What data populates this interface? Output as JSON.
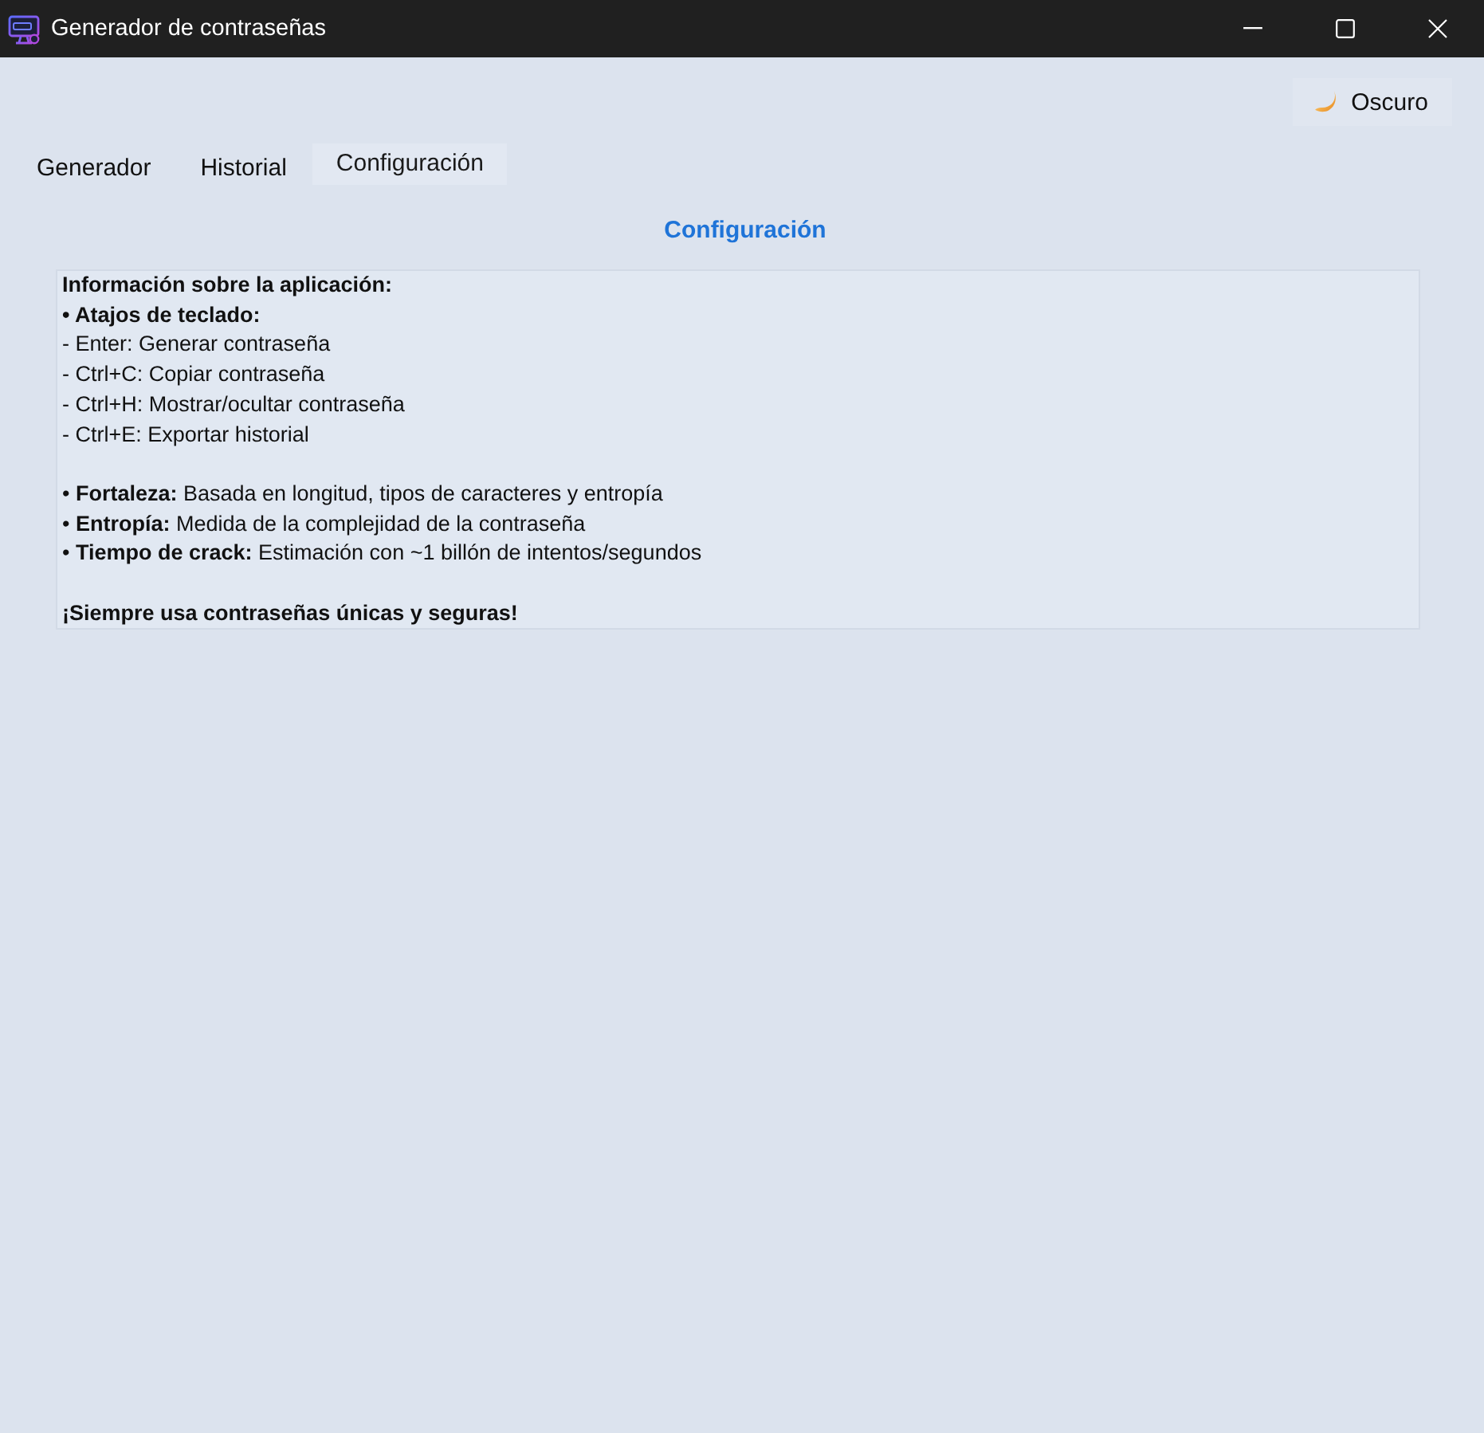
{
  "window": {
    "title": "Generador de contraseñas"
  },
  "theme_toggle": {
    "label": "Oscuro"
  },
  "tabs": [
    {
      "label": "Generador",
      "selected": false
    },
    {
      "label": "Historial",
      "selected": false
    },
    {
      "label": "Configuración",
      "selected": true
    }
  ],
  "settings_panel": {
    "heading": "Configuración",
    "info_blocks": [
      [
        {
          "kind": "title",
          "text": "Información sobre la aplicación:"
        },
        {
          "kind": "heading",
          "text": "• Atajos de teclado:"
        },
        {
          "kind": "item",
          "text": "- Enter: Generar contraseña"
        },
        {
          "kind": "item",
          "text": "- Ctrl+C: Copiar contraseña"
        },
        {
          "kind": "item",
          "text": "- Ctrl+H: Mostrar/ocultar contraseña"
        },
        {
          "kind": "item",
          "text": "- Ctrl+E: Exportar historial"
        }
      ],
      [
        {
          "kind": "item",
          "text": "• **Fortaleza:** Basada en longitud, tipos de caracteres y entropía"
        },
        {
          "kind": "item",
          "text": "• **Entropía:** Medida de la complejidad de la contraseña"
        },
        {
          "kind": "item",
          "text": "• **Tiempo de crack:** Estimación con ~1 billón de intentos/segundos"
        }
      ],
      [
        {
          "kind": "note",
          "text": "¡Siempre usa contraseñas únicas y seguras!"
        }
      ]
    ]
  }
}
